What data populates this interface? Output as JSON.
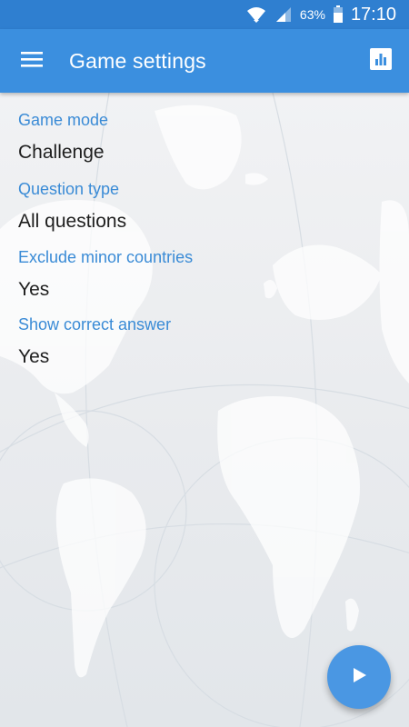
{
  "status_bar": {
    "battery": "63%",
    "time": "17:10",
    "icons": [
      "wifi-icon",
      "signal-icon",
      "battery-icon"
    ]
  },
  "app_bar": {
    "title": "Game settings",
    "menu_icon": "hamburger-menu-icon",
    "stats_icon": "bar-chart-icon"
  },
  "settings": [
    {
      "label": "Game mode",
      "value": "Challenge"
    },
    {
      "label": "Question type",
      "value": "All questions"
    },
    {
      "label": "Exclude minor countries",
      "value": "Yes"
    },
    {
      "label": "Show correct answer",
      "value": "Yes"
    }
  ],
  "fab": {
    "icon": "play-icon"
  },
  "colors": {
    "status_bar": "#2f7fd0",
    "app_bar": "#3b8fdf",
    "label": "#3a8bd6",
    "value": "#1e1e1e",
    "fab": "#4a97e3"
  }
}
